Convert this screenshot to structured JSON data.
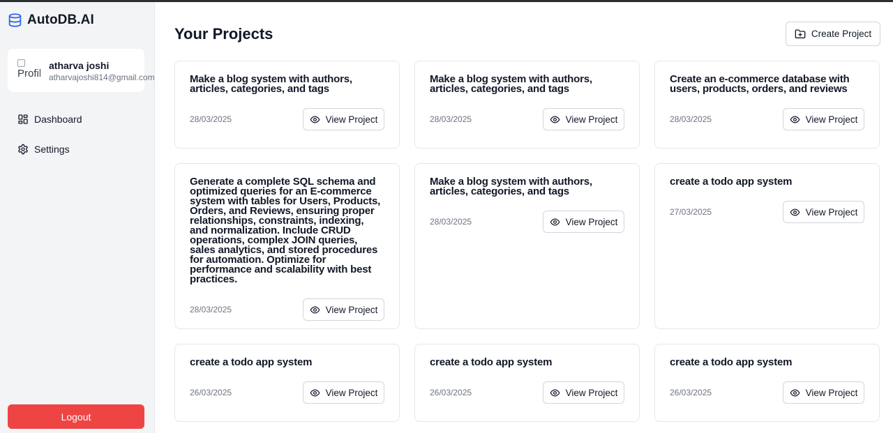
{
  "app": {
    "brand": "AutoDB.AI"
  },
  "user": {
    "avatar_alt": "Profile",
    "name": "atharva joshi",
    "email": "atharvajoshi814@gmail.com"
  },
  "nav": {
    "items": [
      {
        "label": "Dashboard",
        "icon": "dashboard-icon"
      },
      {
        "label": "Settings",
        "icon": "gear-icon"
      }
    ]
  },
  "logout_label": "Logout",
  "main": {
    "title": "Your Projects",
    "create_label": "Create Project"
  },
  "projects": [
    {
      "title": "Make a blog system with authors, articles, categories, and tags",
      "date": "28/03/2025",
      "button": "View Project"
    },
    {
      "title": "Make a blog system with authors, articles, categories, and tags",
      "date": "28/03/2025",
      "button": "View Project"
    },
    {
      "title": "Create an e-commerce database with users, products, orders, and reviews",
      "date": "28/03/2025",
      "button": "View Project"
    },
    {
      "title": "Generate a complete SQL schema and optimized queries for an E-commerce system with tables for Users, Products, Orders, and Reviews, ensuring proper relationships, constraints, indexing, and normalization. Include CRUD operations, complex JOIN queries, sales analytics, and stored procedures for automation. Optimize for performance and scalability with best practices.",
      "date": "28/03/2025",
      "button": "View Project"
    },
    {
      "title": "Make a blog system with authors, articles, categories, and tags",
      "date": "28/03/2025",
      "button": "View Project"
    },
    {
      "title": "create a todo app system",
      "date": "27/03/2025",
      "button": "View Project"
    },
    {
      "title": "create a todo app system",
      "date": "26/03/2025",
      "button": "View Project"
    },
    {
      "title": "create a todo app system",
      "date": "26/03/2025",
      "button": "View Project"
    },
    {
      "title": "create a todo app system",
      "date": "26/03/2025",
      "button": "View Project"
    }
  ],
  "colors": {
    "logout_bg": "#ef4444",
    "brand_icon": "#2563eb",
    "sidebar_bg": "#f3f4f6",
    "card_border": "#e5e7eb"
  }
}
